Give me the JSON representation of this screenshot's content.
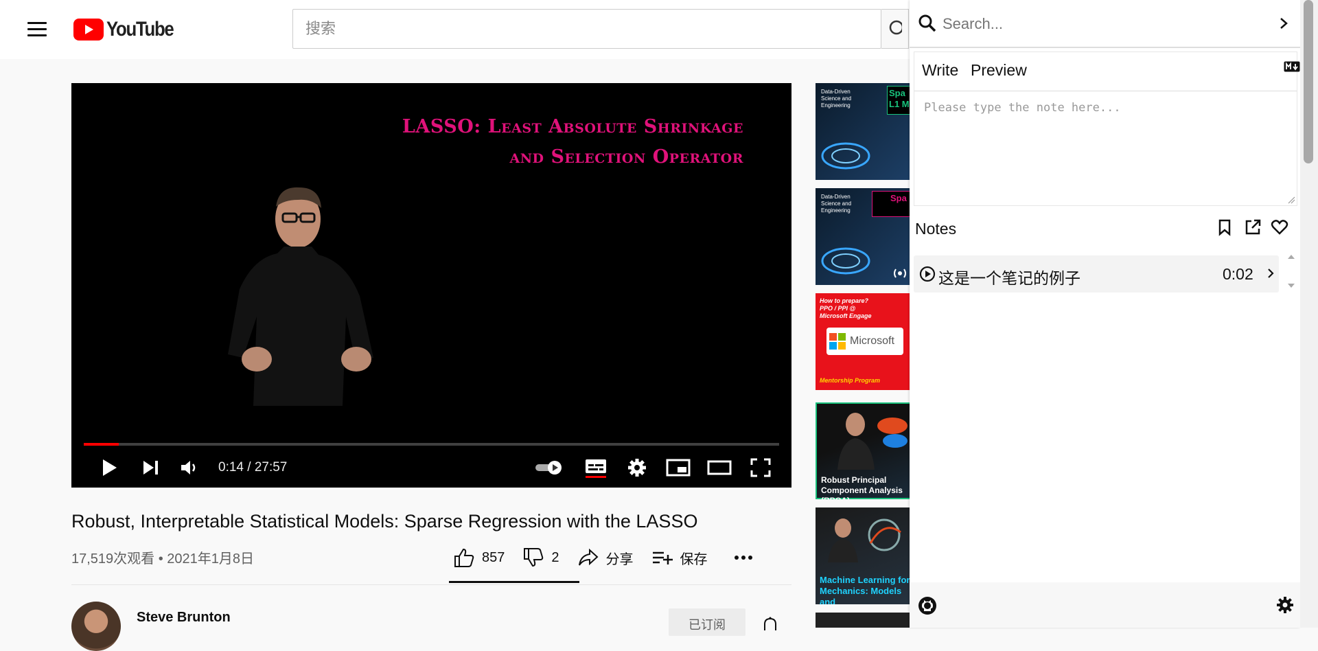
{
  "masthead": {
    "logo_text": "YouTube",
    "search_placeholder": "搜索"
  },
  "player": {
    "slide_title_line1": "LASSO: Least Absolute Shrinkage",
    "slide_title_line2": "and Selection Operator",
    "time_display": "0:14 / 27:57",
    "progress_fraction": 0.05,
    "accent_color": "#ff0000"
  },
  "video": {
    "title": "Robust, Interpretable Statistical Models: Sparse Regression with the LASSO",
    "meta": "17,519次观看 • 2021年1月8日",
    "like_count": "857",
    "dislike_count": "2",
    "share_label": "分享",
    "save_label": "保存"
  },
  "channel": {
    "name": "Steve Brunton",
    "subscribe_label": "已订阅"
  },
  "recommendations": [
    {
      "caption": "Data-Driven Science and Engineering",
      "overlay": "Spa L1 M"
    },
    {
      "caption": "Data-Driven Science and Engineering",
      "overlay": "Spa"
    },
    {
      "caption": "How to prepare? PPO / PPI @ Microsoft Engage",
      "overlay": "Mentorship Program"
    },
    {
      "caption": "Robust Principal Component Analysis (RPCA)",
      "overlay": ""
    },
    {
      "caption": "Machine Learning for Mechanics: Models and",
      "overlay": ""
    }
  ],
  "notes_panel": {
    "search_placeholder": "Search...",
    "tab_write": "Write",
    "tab_preview": "Preview",
    "note_placeholder": "Please type the note here...",
    "notes_heading": "Notes",
    "notes": [
      {
        "text": "这是一个笔记的例子",
        "time": "0:02"
      }
    ]
  }
}
